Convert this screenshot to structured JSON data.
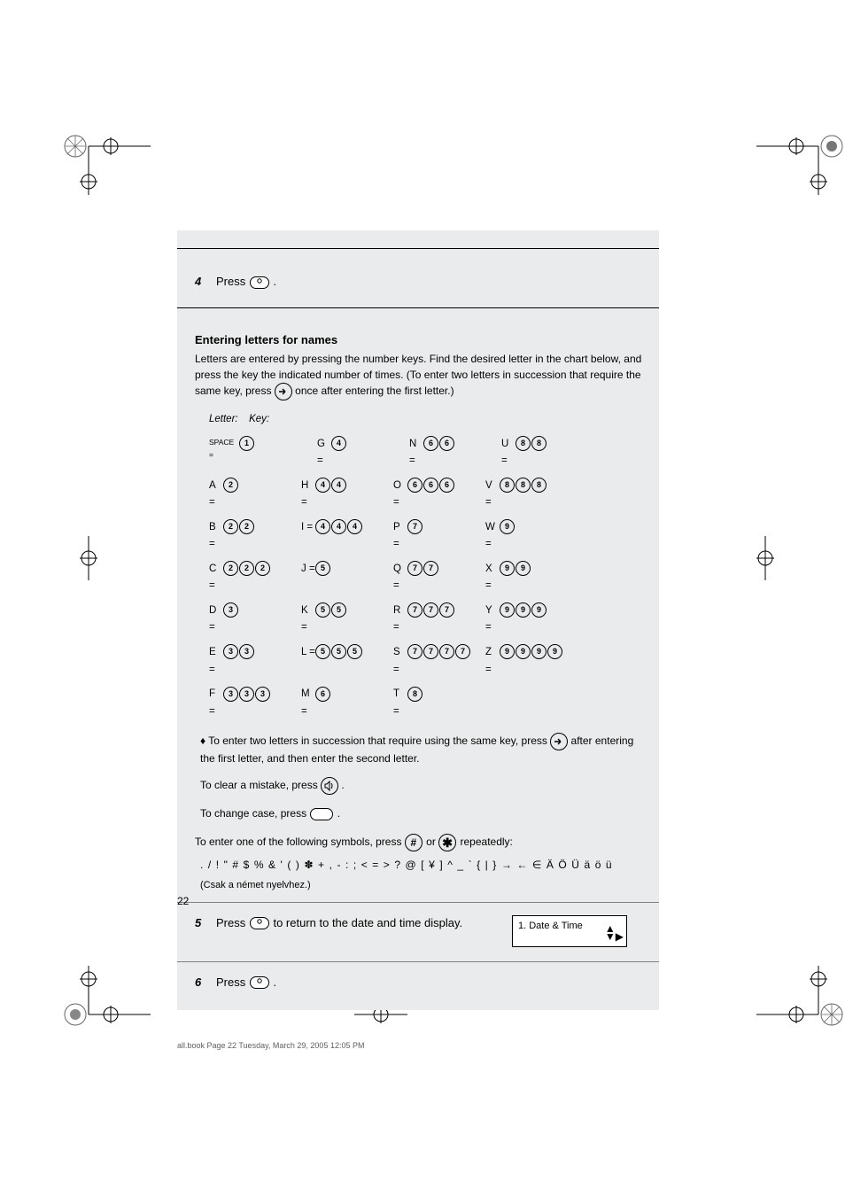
{
  "step4": {
    "num": "4",
    "text_before": "Press ",
    "key": "STOP",
    "text_after": "."
  },
  "entering_letters": {
    "title": "Entering letters for names",
    "intro": "Letters are entered by pressing the number keys. Find the desired letter in the chart below, and press the key the indicated number of times. (To enter two letters in succession that require the same key, press         once after entering the first letter.)",
    "final_note": "♦ To enter two letters in succession that require using the same key, press         after entering the first letter, and then enter the second letter.",
    "clear_note_before": "To clear a mistake, press ",
    "clear_note_after": ".",
    "lowercase_note_before": "To change case, press ",
    "lowercase_note_after": ".",
    "table": [
      {
        "letter": "SPACE",
        "keys": [
          "1"
        ]
      },
      {
        "letter": "A",
        "keys": [
          "2"
        ]
      },
      {
        "letter": "B",
        "keys": [
          "2",
          "2"
        ]
      },
      {
        "letter": "C",
        "keys": [
          "2",
          "2",
          "2"
        ]
      },
      {
        "letter": "D",
        "keys": [
          "3"
        ]
      },
      {
        "letter": "E",
        "keys": [
          "3",
          "3"
        ]
      },
      {
        "letter": "F",
        "keys": [
          "3",
          "3",
          "3"
        ]
      },
      {
        "letter": "G",
        "keys": [
          "4"
        ]
      },
      {
        "letter": "H",
        "keys": [
          "4",
          "4"
        ]
      },
      {
        "letter": "I",
        "keys": [
          "4",
          "4",
          "4"
        ]
      },
      {
        "letter": "J",
        "keys": [
          "5"
        ]
      },
      {
        "letter": "K",
        "keys": [
          "5",
          "5"
        ]
      },
      {
        "letter": "L",
        "keys": [
          "5",
          "5",
          "5"
        ]
      },
      {
        "letter": "M",
        "keys": [
          "6"
        ]
      },
      {
        "letter": "N",
        "keys": [
          "6",
          "6"
        ]
      },
      {
        "letter": "O",
        "keys": [
          "6",
          "6",
          "6"
        ]
      },
      {
        "letter": "P",
        "keys": [
          "7"
        ]
      },
      {
        "letter": "Q",
        "keys": [
          "7",
          "7"
        ]
      },
      {
        "letter": "R",
        "keys": [
          "7",
          "7",
          "7"
        ]
      },
      {
        "letter": "S",
        "keys": [
          "7",
          "7",
          "7",
          "7"
        ]
      },
      {
        "letter": "T",
        "keys": [
          "8"
        ]
      },
      {
        "letter": "U",
        "keys": [
          "8",
          "8"
        ]
      },
      {
        "letter": "V",
        "keys": [
          "8",
          "8",
          "8"
        ]
      },
      {
        "letter": "W",
        "keys": [
          "9"
        ]
      },
      {
        "letter": "X",
        "keys": [
          "9",
          "9"
        ]
      },
      {
        "letter": "Y",
        "keys": [
          "9",
          "9",
          "9"
        ]
      },
      {
        "letter": "Z",
        "keys": [
          "9",
          "9",
          "9",
          "9"
        ]
      }
    ],
    "table_header": {
      "letter": "Letter:",
      "key": "Key:"
    }
  },
  "symbols": {
    "intro_before": "To enter one of the following symbols, press ",
    "intro_mid": " or ",
    "intro_after": " repeatedly:",
    "chars": ". / ! \" # $ % & ' ( ) ✽ + , - : ; < = > ? @ [ ¥ ] ^ _ ` { | } → ← ∈ Ä Ö Ü ä ö ü",
    "csak": "(Csak a német nyelvhez.)"
  },
  "step5": {
    "num": "5",
    "text_before": "Press ",
    "key": "STOP",
    "text_after": " to return to the date and time display."
  },
  "step6": {
    "num": "6",
    "text_before": "Press ",
    "key": "STOP",
    "text_after": "."
  },
  "navbox": {
    "line1": "1. Date & Time",
    "line2": ""
  },
  "page_number": "22",
  "footer_file": "all.book  Page 22  Tuesday, March 29, 2005  12:05 PM"
}
